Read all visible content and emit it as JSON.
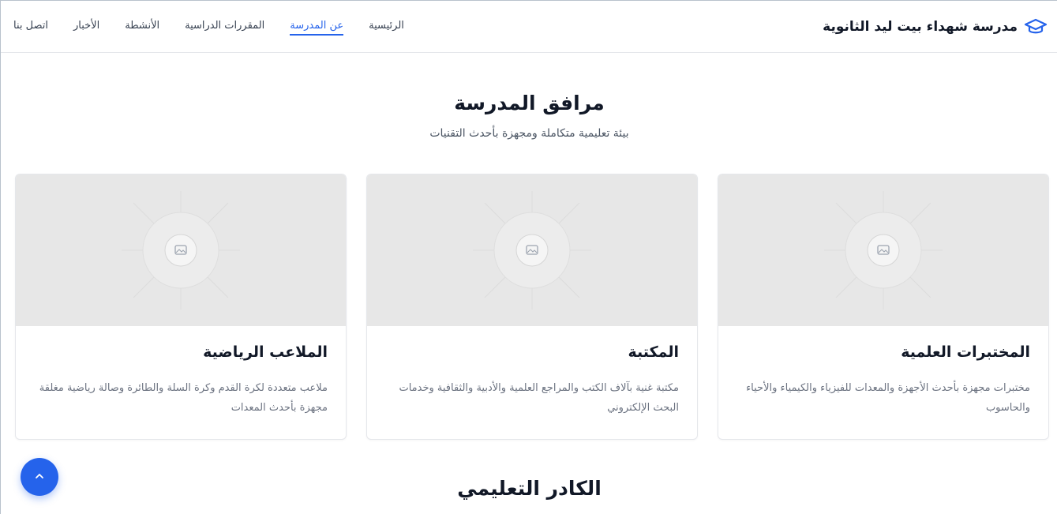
{
  "header": {
    "brand_title": "مدرسة شهداء بيت ليد الثانوية",
    "brand_icon": "graduation-cap-icon",
    "nav": [
      {
        "label": "الرئيسية",
        "active": false
      },
      {
        "label": "عن المدرسة",
        "active": true
      },
      {
        "label": "المقررات الدراسية",
        "active": false
      },
      {
        "label": "الأنشطة",
        "active": false
      },
      {
        "label": "الأخبار",
        "active": false
      },
      {
        "label": "اتصل بنا",
        "active": false
      }
    ]
  },
  "facilities": {
    "title": "مرافق المدرسة",
    "subtitle": "بيئة تعليمية متكاملة ومجهزة بأحدث التقنيات",
    "cards": [
      {
        "title": "المختبرات العلمية",
        "description": "مختبرات مجهزة بأحدث الأجهزة والمعدات للفيزياء والكيمياء والأحياء والحاسوب"
      },
      {
        "title": "المكتبة",
        "description": "مكتبة غنية بآلاف الكتب والمراجع العلمية والأدبية والثقافية وخدمات البحث الإلكتروني"
      },
      {
        "title": "الملاعب الرياضية",
        "description": "ملاعب متعددة لكرة القدم وكرة السلة والطائرة وصالة رياضية مغلقة مجهزة بأحدث المعدات"
      }
    ]
  },
  "staff": {
    "title": "الكادر التعليمي"
  },
  "scroll_top_icon": "chevron-up-icon",
  "colors": {
    "accent": "#2563eb",
    "placeholder_bg": "#e7e7e7"
  }
}
